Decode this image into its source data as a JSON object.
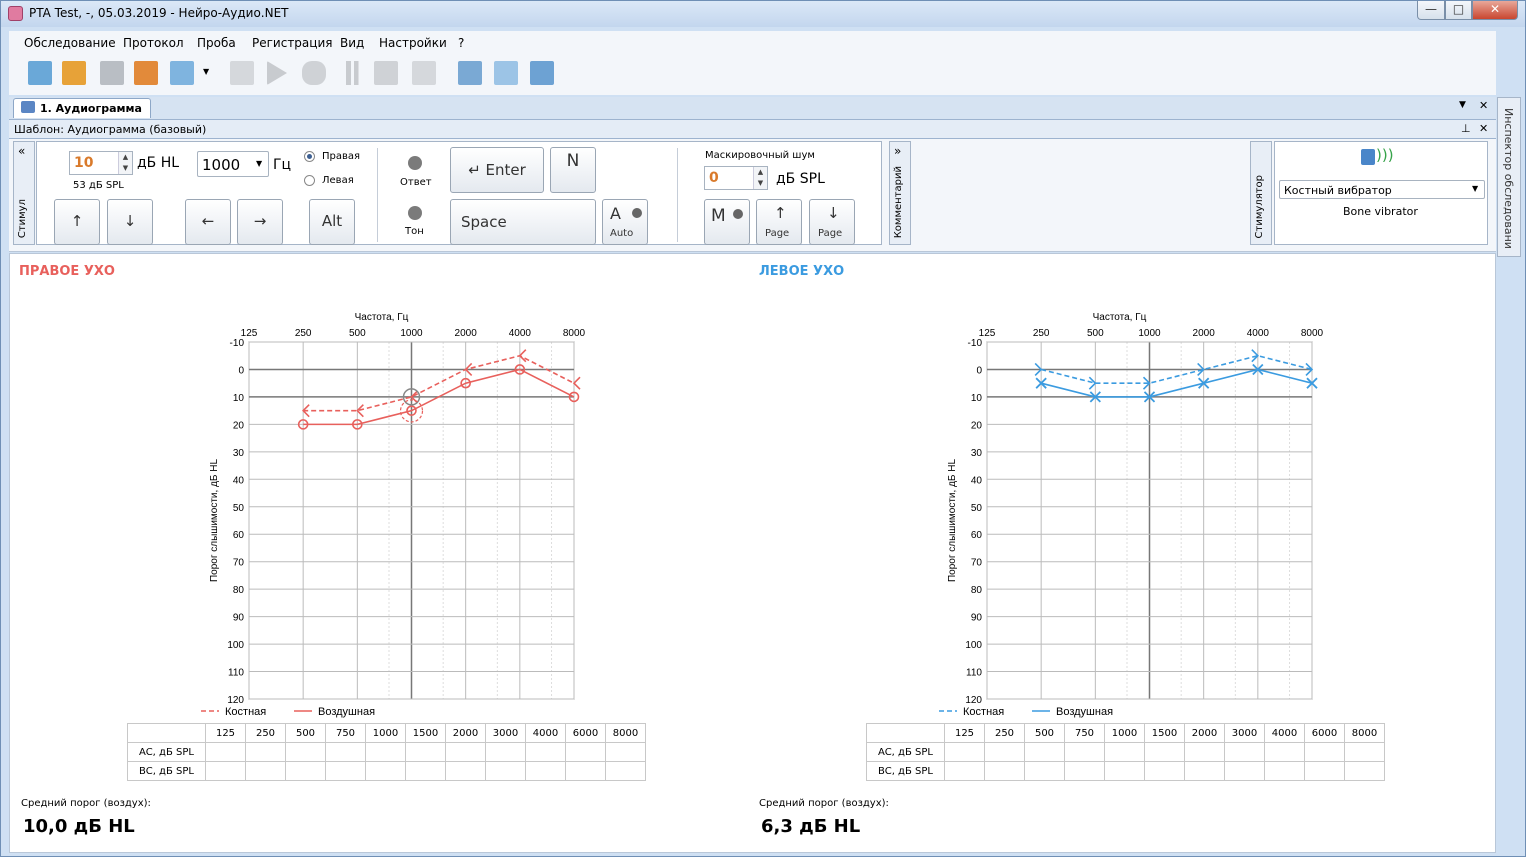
{
  "window": {
    "title": "PTA Test, -, 05.03.2019 - Нейро-Аудио.NET",
    "btn_min": "—",
    "btn_max": "□",
    "btn_close": "✕"
  },
  "menu": [
    "Обследование",
    "Протокол",
    "Проба",
    "Регистрация",
    "Вид",
    "Настройки",
    "?"
  ],
  "toolbar_icons": [
    "new-exam-icon",
    "open-exam-icon",
    "save-icon",
    "export-icon",
    "add-test-icon",
    "calibrate-icon",
    "play-icon",
    "hand-icon",
    "pause-icon",
    "stop-icon",
    "cancel-icon",
    "settings-wand-icon",
    "add-report-icon",
    "connect-icon"
  ],
  "tab": {
    "label": "1. Аудиограмма"
  },
  "template": {
    "label": "Шаблон: Аудиограмма (базовый)"
  },
  "stimulus": {
    "side_tab": "Стимул",
    "level_value": "10",
    "level_unit": "дБ HL",
    "level_spl": "53 дБ SPL",
    "freq_value": "1000",
    "freq_unit": "Гц",
    "radio_right": "Правая",
    "radio_left": "Левая",
    "response_label": "Ответ",
    "tone_label": "Тон",
    "enter_label": "Enter",
    "n_label": "N",
    "space_label": "Space",
    "alt_label": "Alt",
    "a_label": "A",
    "auto_label": "Auto",
    "masking_title": "Маскировочный шум",
    "masking_value": "0",
    "masking_unit": "дБ SPL",
    "m_label": "M",
    "page_label": "Page",
    "comment_tab": "Комментарий"
  },
  "stimulator": {
    "side_tab": "Стимулятор",
    "select": "Костный вибратор",
    "device": "Bone vibrator"
  },
  "inspector": {
    "label": "Инспектор обследовани"
  },
  "right_ear": {
    "title": "ПРАВОЕ УХО",
    "color": "#e8605c",
    "avg_label": "Средний порог (воздух):",
    "avg_value": "10,0 дБ HL"
  },
  "left_ear": {
    "title": "ЛЕВОЕ УХО",
    "color": "#3b9be0",
    "avg_label": "Средний порог (воздух):",
    "avg_value": "6,3 дБ HL"
  },
  "chart_data": [
    {
      "type": "line",
      "title": "ПРАВОЕ УХО",
      "xlabel": "Частота, Гц",
      "ylabel": "Порог слышимости, дБ HL",
      "x": [
        125,
        250,
        500,
        1000,
        2000,
        4000,
        8000
      ],
      "x_ticks": [
        "125",
        "250",
        "500",
        "1000",
        "2000",
        "4000",
        "8000"
      ],
      "y_ticks": [
        "-10",
        "0",
        "10",
        "20",
        "30",
        "40",
        "50",
        "60",
        "70",
        "80",
        "90",
        "100",
        "110",
        "120"
      ],
      "ylim": [
        -10,
        120
      ],
      "y_inverted": true,
      "series": [
        {
          "name": "Костная",
          "style": "dashed",
          "marker": "<",
          "x": [
            250,
            500,
            1000,
            2000,
            4000,
            8000
          ],
          "values": [
            15,
            15,
            10,
            0,
            -5,
            5
          ]
        },
        {
          "name": "Воздушная",
          "style": "solid",
          "marker": "o",
          "x": [
            250,
            500,
            1000,
            2000,
            4000,
            8000
          ],
          "values": [
            20,
            20,
            15,
            5,
            0,
            10
          ]
        }
      ],
      "legend": "bottom-left"
    },
    {
      "type": "line",
      "title": "ЛЕВОЕ УХО",
      "xlabel": "Частота, Гц",
      "ylabel": "Порог слышимости, дБ HL",
      "x": [
        125,
        250,
        500,
        1000,
        2000,
        4000,
        8000
      ],
      "x_ticks": [
        "125",
        "250",
        "500",
        "1000",
        "2000",
        "4000",
        "8000"
      ],
      "y_ticks": [
        "-10",
        "0",
        "10",
        "20",
        "30",
        "40",
        "50",
        "60",
        "70",
        "80",
        "90",
        "100",
        "110",
        "120"
      ],
      "ylim": [
        -10,
        120
      ],
      "y_inverted": true,
      "series": [
        {
          "name": "Костная",
          "style": "dashed",
          "marker": ">",
          "x": [
            250,
            500,
            1000,
            2000,
            4000,
            8000
          ],
          "values": [
            0,
            5,
            5,
            0,
            -5,
            0
          ]
        },
        {
          "name": "Воздушная",
          "style": "solid",
          "marker": "x",
          "x": [
            250,
            500,
            1000,
            2000,
            4000,
            8000
          ],
          "values": [
            5,
            10,
            10,
            5,
            0,
            5
          ]
        }
      ],
      "legend": "bottom-left"
    }
  ],
  "freq_table": {
    "headers": [
      "",
      "125",
      "250",
      "500",
      "750",
      "1000",
      "1500",
      "2000",
      "3000",
      "4000",
      "6000",
      "8000"
    ],
    "rows": [
      "AC, дБ SPL",
      "BC, дБ SPL"
    ]
  }
}
